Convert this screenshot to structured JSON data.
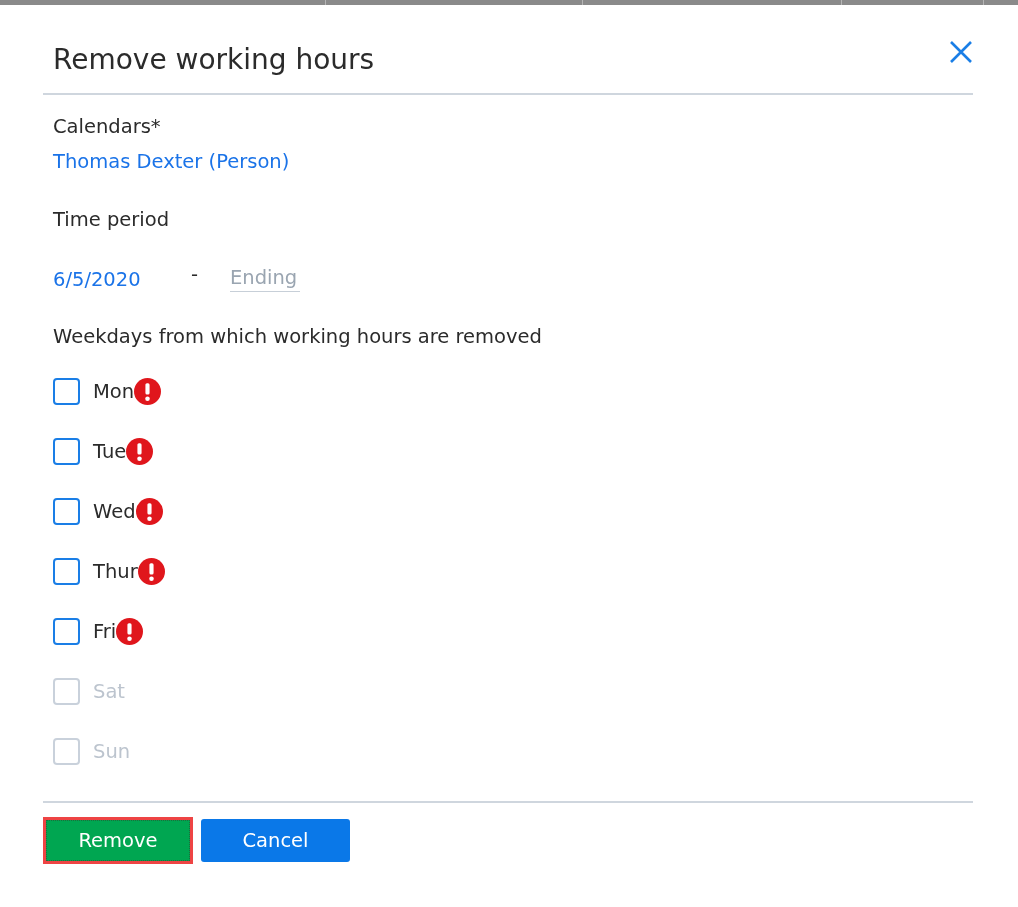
{
  "dialog": {
    "title": "Remove working hours"
  },
  "calendars": {
    "label": "Calendars*",
    "value": "Thomas Dexter (Person)"
  },
  "time_period": {
    "label": "Time period",
    "start": "6/5/2020",
    "separator": "-",
    "end": {
      "placeholder": "Ending"
    }
  },
  "weekdays": {
    "label": "Weekdays from which working hours are removed",
    "days": [
      {
        "label": "Mon",
        "checked": false,
        "disabled": false,
        "error": true
      },
      {
        "label": "Tue",
        "checked": false,
        "disabled": false,
        "error": true
      },
      {
        "label": "Wed",
        "checked": false,
        "disabled": false,
        "error": true
      },
      {
        "label": "Thur",
        "checked": false,
        "disabled": false,
        "error": true
      },
      {
        "label": "Fri",
        "checked": false,
        "disabled": false,
        "error": true
      },
      {
        "label": "Sat",
        "checked": false,
        "disabled": true,
        "error": false
      },
      {
        "label": "Sun",
        "checked": false,
        "disabled": true,
        "error": false
      }
    ]
  },
  "buttons": [
    {
      "label": "Remove",
      "kind": "confirm",
      "highlighted": true
    },
    {
      "label": "Cancel",
      "kind": "cancel",
      "highlighted": false
    }
  ]
}
